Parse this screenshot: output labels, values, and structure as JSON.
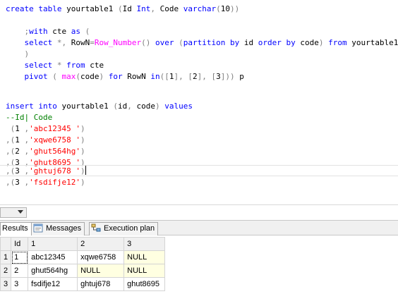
{
  "editor": {
    "lines": {
      "l1": {
        "kw1": "create table",
        "plain1": " yourtable1 ",
        "op1": "(",
        "plain2": "Id ",
        "kw2": "Int",
        "op2": ",",
        "plain3": " Code ",
        "kw3": "varchar",
        "op3": "(",
        "plain4": "10",
        "op4": "))"
      },
      "l2": {
        "plain1": "    ",
        "op1": ";",
        "kw1": "with",
        "plain2": " cte ",
        "kw2": "as",
        "plain3": " ",
        "op2": "("
      },
      "l3": {
        "plain1": "    ",
        "kw1": "select",
        "plain2": " ",
        "op1": "*,",
        "plain3": " RowN",
        "op2": "=",
        "fn1": "Row_Number",
        "op3": "()",
        "plain4": " ",
        "kw2": "over",
        "plain5": " ",
        "op4": "(",
        "kw3": "partition by",
        "plain6": " id ",
        "kw4": "order by",
        "plain7": " code",
        "op5": ")",
        "plain8": " ",
        "kw5": "from",
        "plain9": " yourtable1"
      },
      "l4": {
        "plain1": "    ",
        "op1": ")"
      },
      "l5": {
        "plain1": "    ",
        "kw1": "select",
        "plain2": " ",
        "op1": "*",
        "plain3": " ",
        "kw2": "from",
        "plain4": " cte"
      },
      "l6": {
        "plain1": "    ",
        "kw1": "pivot",
        "plain2": " ",
        "op1": "(",
        "plain3": " ",
        "fn1": "max",
        "op2": "(",
        "plain4": "code",
        "op3": ")",
        "plain5": " ",
        "kw2": "for",
        "plain6": " RowN ",
        "op4": "in",
        "op5": "([",
        "plain7": "1",
        "op6": "],",
        "plain8": " ",
        "op7": "[",
        "plain9": "2",
        "op8": "],",
        "plain10": " ",
        "op9": "[",
        "plain11": "3",
        "op10": "]))",
        "plain12": " p"
      },
      "l7": {
        "kw1": "insert into",
        "plain1": " yourtable1 ",
        "op1": "(",
        "plain2": "id",
        "op2": ",",
        "plain3": " code",
        "op3": ")",
        "plain4": " ",
        "kw2": "values"
      },
      "l8": {
        "cm1": "--Id| Code"
      },
      "l9": {
        "plain1": " ",
        "op1": "(",
        "plain2": "1 ",
        "op2": ",",
        "str1": "'abc12345 '",
        "op3": ")"
      },
      "l10": {
        "op1": ",(",
        "plain1": "1 ",
        "op2": ",",
        "str1": "'xqwe6758 '",
        "op3": ")"
      },
      "l11": {
        "op1": ",(",
        "plain1": "2 ",
        "op2": ",",
        "str1": "'ghut564hg'",
        "op3": ")"
      },
      "l12": {
        "op1": ",(",
        "plain1": "3 ",
        "op2": ",",
        "str1": "'ghut8695 '",
        "op3": ")"
      },
      "l13": {
        "op1": ",(",
        "plain1": "3 ",
        "op2": ",",
        "str1": "'ghtuj678 '",
        "op3": ")"
      },
      "l14": {
        "op1": ",(",
        "plain1": "3 ",
        "op2": ",",
        "str1": "'fsdifje12'",
        "op3": ")"
      }
    }
  },
  "tabs": {
    "results": "Results",
    "messages": "Messages",
    "execution_plan": "Execution plan"
  },
  "grid": {
    "columns": [
      "Id",
      "1",
      "2",
      "3"
    ],
    "rows": [
      {
        "rownum": "1",
        "id": "1",
        "c1": "abc12345",
        "c2": "xqwe6758",
        "c3": "NULL"
      },
      {
        "rownum": "2",
        "id": "2",
        "c1": "ghut564hg",
        "c2": "NULL",
        "c3": "NULL"
      },
      {
        "rownum": "3",
        "id": "3",
        "c1": "fsdifje12",
        "c2": "ghtuj678",
        "c3": "ghut8695"
      }
    ]
  },
  "colors": {
    "keyword": "#0000ff",
    "function": "#ff00ff",
    "operator": "#808080",
    "string": "#ff0000",
    "comment": "#008000",
    "null_cell": "#ffffe1"
  }
}
